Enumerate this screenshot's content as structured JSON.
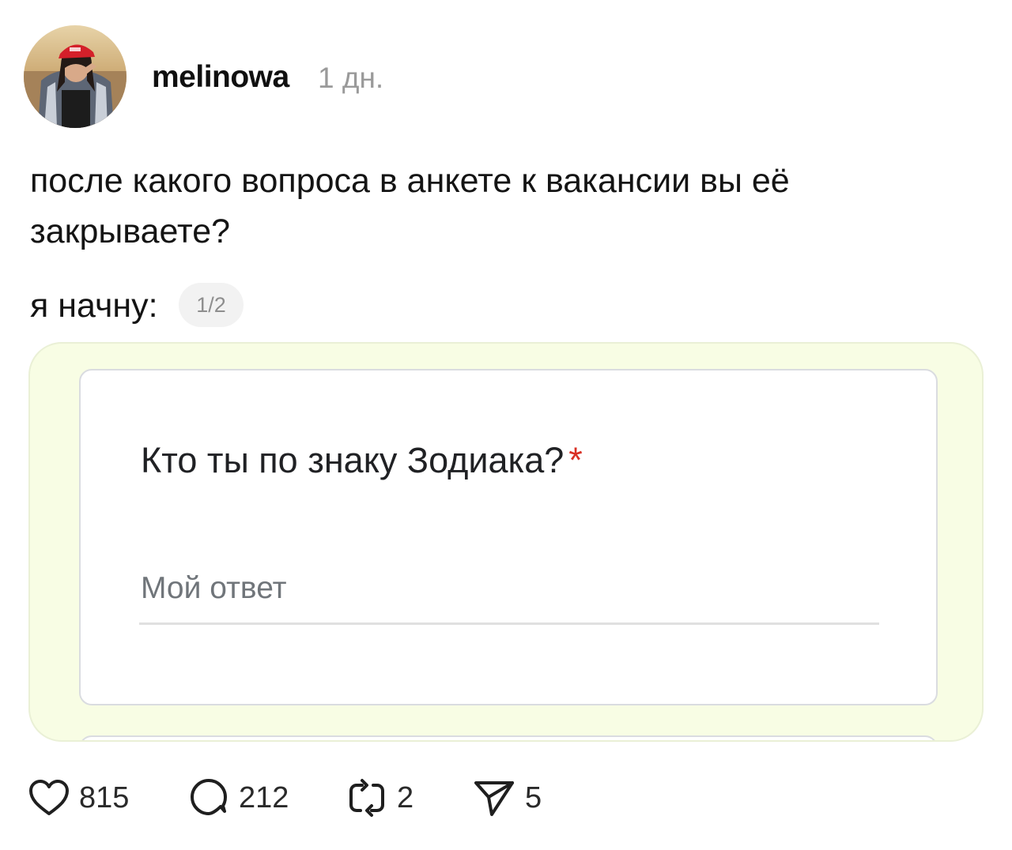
{
  "post": {
    "author": "melinowa",
    "time_ago": "1 дн.",
    "text_line_1": "после какого вопроса в анкете к вакансии вы её закрываете?",
    "text_line_2": "я начну:",
    "media_counter": "1/2"
  },
  "form": {
    "question": "Кто ты по знаку Зодиака?",
    "required_marker": "*",
    "answer_placeholder": "Мой ответ"
  },
  "actions": {
    "likes": "815",
    "comments": "212",
    "reposts": "2",
    "shares": "5"
  },
  "colors": {
    "frame_background": "#f8fde4",
    "required_red": "#d93025",
    "muted_gray": "#9a9a9a"
  },
  "icons": [
    "heart-icon",
    "comment-icon",
    "repost-icon",
    "share-icon"
  ]
}
